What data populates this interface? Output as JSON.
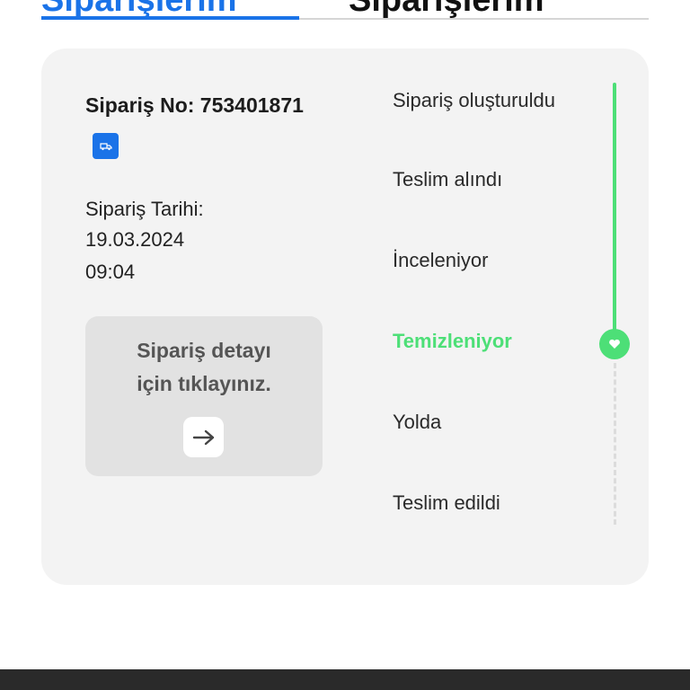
{
  "tabs": [
    {
      "label": "Siparişlerim",
      "active": true
    },
    {
      "label": "Siparişlerim",
      "active": false
    }
  ],
  "order": {
    "number_text": "Sipariş No: 753401871",
    "copy_icon": "truck-icon",
    "date_label": "Sipariş Tarihi:",
    "date": "19.03.2024",
    "time": "09:04",
    "detail_text": "Sipariş detayı\niçin tıklayınız.",
    "detail_icon": "arrow-right-icon"
  },
  "statuses": [
    {
      "label": "Sipariş oluşturuldu",
      "state": "done"
    },
    {
      "label": "Teslim alındı",
      "state": "done"
    },
    {
      "label": "İnceleniyor",
      "state": "done"
    },
    {
      "label": "Temizleniyor",
      "state": "current"
    },
    {
      "label": "Yolda",
      "state": "pending"
    },
    {
      "label": "Teslim edildi",
      "state": "pending"
    }
  ],
  "colors": {
    "accent": "#1a73e8",
    "active_status": "#4ddf77",
    "card_bg": "#f3f3f3",
    "detail_bg": "#e2e2e2",
    "bottom_bar": "#2a2a2a"
  }
}
